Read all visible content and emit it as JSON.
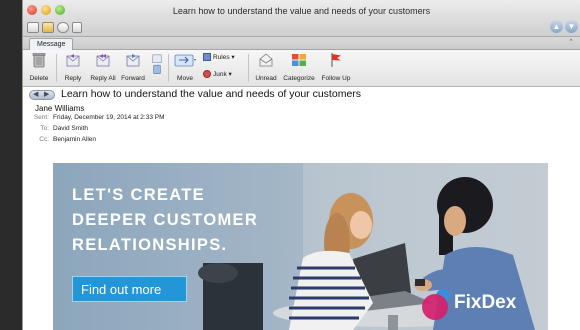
{
  "window": {
    "title": "Learn how to understand the value and needs of your customers"
  },
  "ribbon": {
    "tab": "Message",
    "buttons": {
      "delete": "Delete",
      "reply": "Reply",
      "reply_all": "Reply All",
      "forward": "Forward",
      "move": "Move",
      "rules": "Rules",
      "junk": "Junk",
      "unread": "Unread",
      "categorize": "Categorize",
      "follow_up": "Follow Up"
    }
  },
  "message": {
    "subject": "Learn how to understand the value and needs of your customers",
    "from": "Jane Williams",
    "sent_label": "Sent:",
    "sent": "Friday, December 19, 2014 at 2:33 PM",
    "to_label": "To:",
    "to": "David Smith",
    "cc_label": "Cc:",
    "cc": "Benjamin Allen"
  },
  "banner": {
    "headline_line1": "LET'S CREATE",
    "headline_line2": "DEEPER CUSTOMER",
    "headline_line3": "RELATIONSHIPS.",
    "cta": "Find out more",
    "brand": "FixDex"
  },
  "colors": {
    "cta": "#2296d6",
    "logo_magenta": "#d4206e",
    "logo_blue": "#3a8fd8"
  }
}
